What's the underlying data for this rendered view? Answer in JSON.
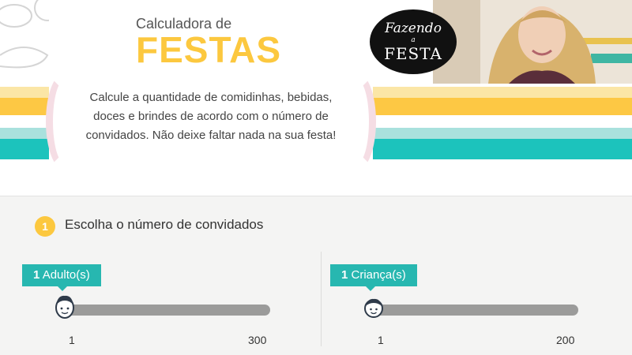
{
  "header": {
    "title_top": "Calculadora de",
    "title_main": "FESTAS",
    "description": "Calcule a quantidade de comidinhas, bebidas, doces e brindes de acordo com o número de convidados. Não deixe faltar nada na sua festa!",
    "logo": {
      "line1": "Fazendo",
      "line2": "a",
      "line3": "FESTA"
    }
  },
  "step1": {
    "number": "1",
    "title": "Escolha o número de convidados"
  },
  "adults_slider": {
    "count": "1",
    "unit": "Adulto(s)",
    "min_label": "1",
    "max_label": "300",
    "value": 1,
    "min": 1,
    "max": 300,
    "icon": "adult-face-icon"
  },
  "kids_slider": {
    "count": "1",
    "unit": "Criança(s)",
    "min_label": "1",
    "max_label": "200",
    "value": 1,
    "min": 1,
    "max": 200,
    "icon": "child-face-icon"
  },
  "colors": {
    "yellow": "#fcc83f",
    "teal": "#27b7b0",
    "stripe_teal": "#1cc3bc",
    "track_gray": "#9b9b9a"
  }
}
